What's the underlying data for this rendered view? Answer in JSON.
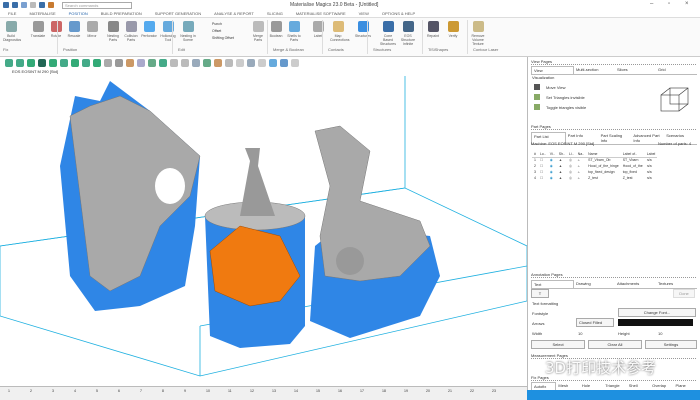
{
  "app": {
    "title": "Materialise Magics 23.0 Beta - [Untitled]",
    "search_placeholder": "Search commands"
  },
  "menu": [
    "FILE",
    "MATERIALISE",
    "POSITION",
    "BUILD PREPARATION",
    "SUPPORT GENERATION",
    "ANALYSE & REPORT",
    "SLICING",
    "MATERIALISE SOFTWARE",
    "VIEW",
    "OPTIONS & HELP"
  ],
  "ribbon": {
    "buttons": [
      "Build Diagnostics",
      "Translate",
      "Rotate",
      "Rescale",
      "Mirror",
      "Nesting Parts",
      "Collision Parts",
      "Perforator",
      "Hollowing Tool",
      "Nesting in Scene",
      "Merge Parts",
      "Boolean",
      "Shells to Parts",
      "Label",
      "Map Connections",
      "Structures",
      "Cone Based Structures",
      "EOS Structure Infinite",
      "Repaint",
      "Verify",
      "Remove Volume Texture"
    ],
    "side_items": [
      "Punch",
      "Offset",
      "Shifting Offset"
    ],
    "groups": [
      "Fix",
      "Position",
      "Edit",
      "Merge & Boolean",
      "Contacts",
      "Structures",
      "TiSiShapes",
      "Contour Laser"
    ]
  },
  "scene": {
    "tab": "EOS EOSINT M 290 [Std]"
  },
  "ruler": [
    "1",
    "2",
    "3",
    "4",
    "5",
    "6",
    "7",
    "8",
    "9",
    "10",
    "11",
    "12",
    "13",
    "14",
    "15",
    "16",
    "17",
    "18",
    "19",
    "20",
    "21",
    "22",
    "23"
  ],
  "view_pages": {
    "title": "View Pages",
    "tabs": [
      "View",
      "Multi-section",
      "Slices",
      "Grid"
    ],
    "section": "Visualization",
    "items": [
      "Move View",
      "Set Triangles invisible",
      "Toggle triangles visible"
    ]
  },
  "part_pages": {
    "title": "Part Pages",
    "tabs": [
      "Part List",
      "Part Info",
      "Part Scaling Info",
      "Advanced Part Info",
      "Scenarios"
    ],
    "machine": "Machine: EOS EOSINT M 290 [Std]",
    "count": "Number of parts: 4",
    "columns": [
      "#",
      "Lo..",
      "Vi..",
      "Sh..",
      "Li..",
      "Na..",
      "Name",
      "Label of..",
      "Label"
    ],
    "rows": [
      [
        "1",
        "ST_Vbarn_Ob",
        "ST_Vbarn",
        "n/a"
      ],
      [
        "2",
        "Hood_of_the_hinge",
        "Hood_of_the",
        "n/a"
      ],
      [
        "3",
        "top_fixed_design",
        "top_fixed",
        "n/a"
      ],
      [
        "4",
        "Z_test",
        "Z_test",
        "n/a"
      ]
    ]
  },
  "annotation_pages": {
    "title": "Annotation Pages",
    "tabs": [
      "Text",
      "Drawing",
      "Attachments",
      "Textures"
    ],
    "dropdown": "T",
    "done": "Done",
    "section": "Text formatting",
    "fontstyle": "Fontstyle",
    "change_font": "Change Font...",
    "arrows_label": "Arrows",
    "arrows_value": "Closed Filled",
    "width_label": "Width",
    "width_value": "10",
    "height_label": "Height",
    "height_value": "10",
    "select": "Select",
    "clear_all": "Clear All",
    "settings": "Settings"
  },
  "measurement_pages": {
    "title": "Measurement Pages"
  },
  "fix_pages": {
    "title": "Fix Pages",
    "tabs": [
      "Autofix",
      "Mesh",
      "Hole",
      "Triangle",
      "Shell",
      "Overlap",
      "Plane"
    ]
  },
  "watermark": "3D打印技术参考",
  "colors": {
    "support": "#2f86e6",
    "part": "#a9a9a9",
    "selected": "#f07a10",
    "accent": "#1e90e0"
  }
}
